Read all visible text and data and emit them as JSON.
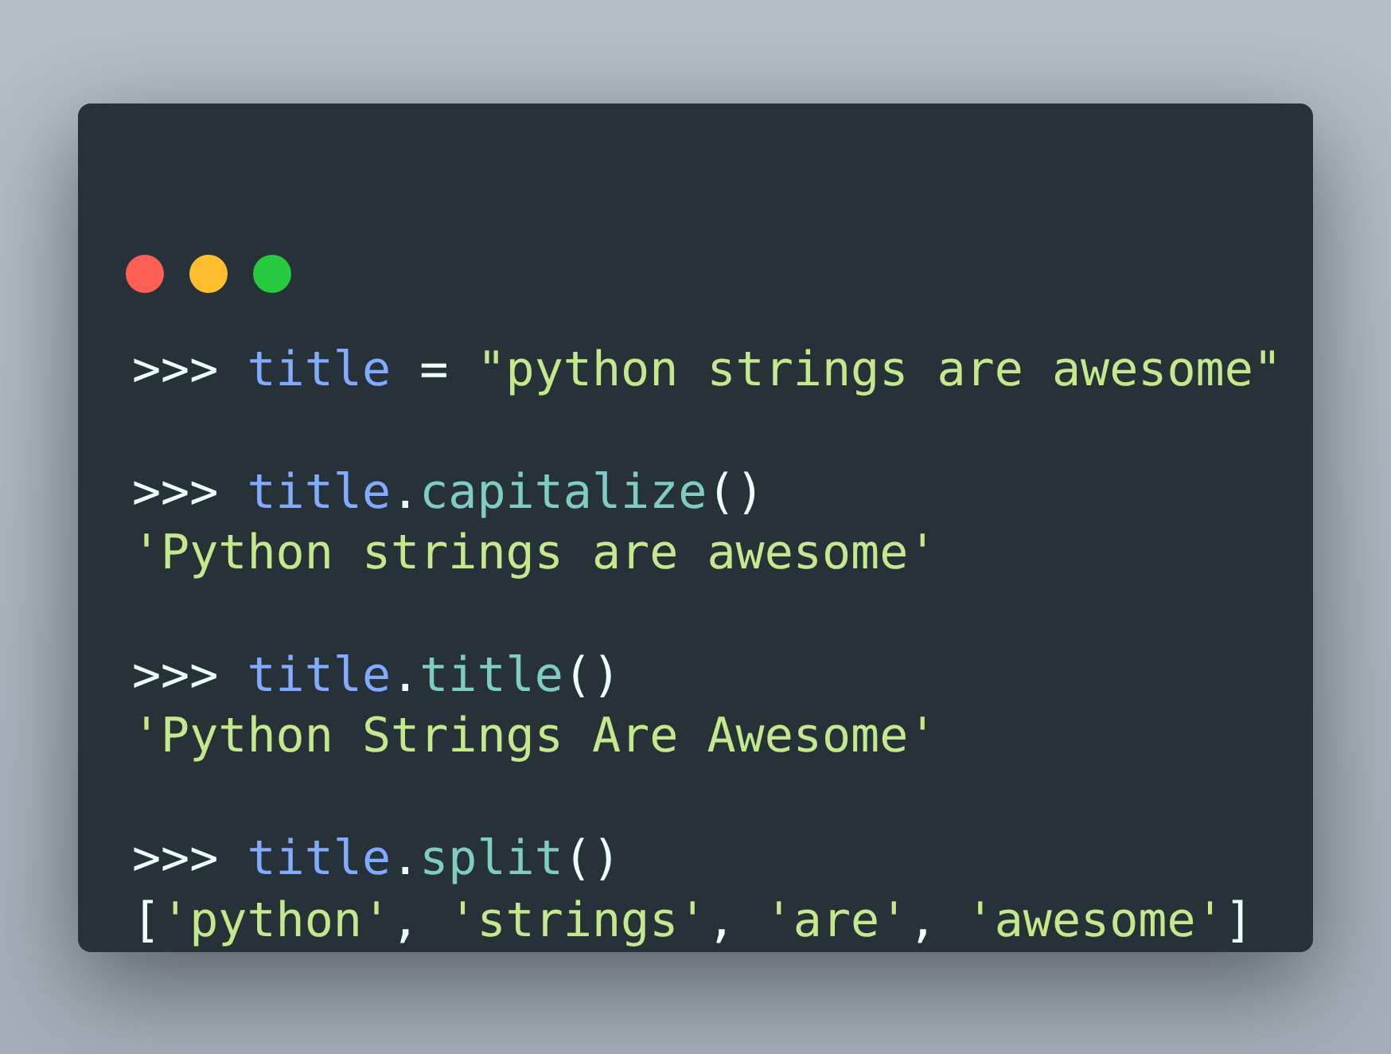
{
  "window_controls": [
    {
      "color": "#ff5f56"
    },
    {
      "color": "#ffbd2e"
    },
    {
      "color": "#27c93f"
    }
  ],
  "code_blocks": [
    [
      [
        {
          "text": ">>> ",
          "kind": "prompt"
        },
        {
          "text": "title",
          "kind": "variable"
        },
        {
          "text": " = ",
          "kind": "operator"
        },
        {
          "text": "\"python strings are awesome\"",
          "kind": "string"
        }
      ]
    ],
    [
      [
        {
          "text": ">>> ",
          "kind": "prompt"
        },
        {
          "text": "title",
          "kind": "variable"
        },
        {
          "text": ".",
          "kind": "operator"
        },
        {
          "text": "capitalize",
          "kind": "method"
        },
        {
          "text": "()",
          "kind": "operator"
        }
      ],
      [
        {
          "text": "'Python strings are awesome'",
          "kind": "string"
        }
      ]
    ],
    [
      [
        {
          "text": ">>> ",
          "kind": "prompt"
        },
        {
          "text": "title",
          "kind": "variable"
        },
        {
          "text": ".",
          "kind": "operator"
        },
        {
          "text": "title",
          "kind": "method"
        },
        {
          "text": "()",
          "kind": "operator"
        }
      ],
      [
        {
          "text": "'Python Strings Are Awesome'",
          "kind": "string"
        }
      ]
    ],
    [
      [
        {
          "text": ">>> ",
          "kind": "prompt"
        },
        {
          "text": "title",
          "kind": "variable"
        },
        {
          "text": ".",
          "kind": "operator"
        },
        {
          "text": "split",
          "kind": "method"
        },
        {
          "text": "()",
          "kind": "operator"
        }
      ],
      [
        {
          "text": "[",
          "kind": "operator"
        },
        {
          "text": "'python'",
          "kind": "string"
        },
        {
          "text": ", ",
          "kind": "operator"
        },
        {
          "text": "'strings'",
          "kind": "string"
        },
        {
          "text": ", ",
          "kind": "operator"
        },
        {
          "text": "'are'",
          "kind": "string"
        },
        {
          "text": ", ",
          "kind": "operator"
        },
        {
          "text": "'awesome'",
          "kind": "string"
        },
        {
          "text": "]",
          "kind": "operator"
        }
      ]
    ]
  ]
}
